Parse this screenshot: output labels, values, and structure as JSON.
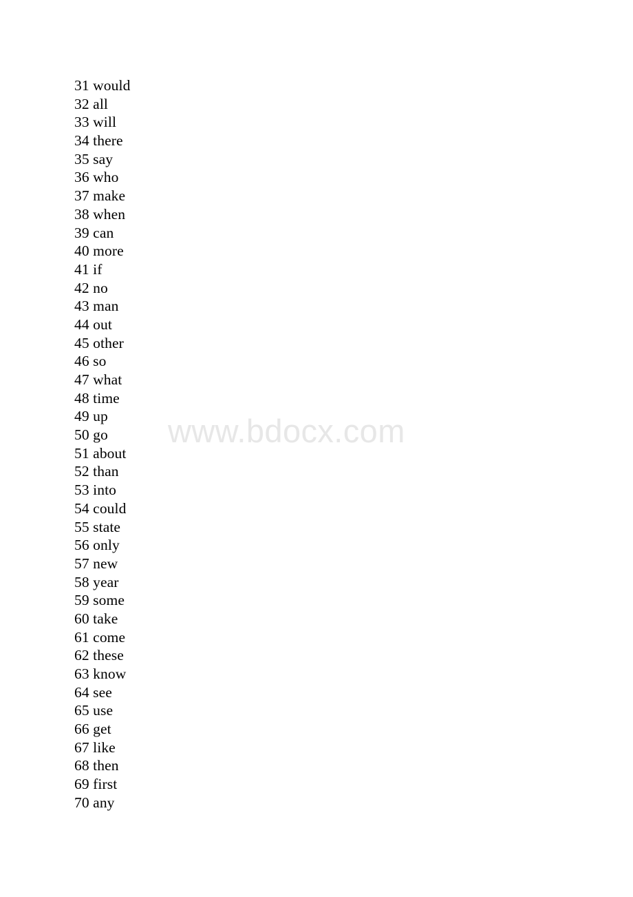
{
  "document": {
    "background_color": "#ffffff",
    "text_color": "#000000",
    "watermark": {
      "text": "www.bdocx.com",
      "color": "#e7e7e7"
    }
  },
  "word_list": {
    "items": [
      {
        "number": "31",
        "word": "would",
        "line": "31 would"
      },
      {
        "number": "32",
        "word": "all",
        "line": "32 all"
      },
      {
        "number": "33",
        "word": "will",
        "line": "33 will"
      },
      {
        "number": "34",
        "word": "there",
        "line": "34 there"
      },
      {
        "number": "35",
        "word": "say",
        "line": "35 say"
      },
      {
        "number": "36",
        "word": "who",
        "line": "36 who"
      },
      {
        "number": "37",
        "word": "make",
        "line": "37 make"
      },
      {
        "number": "38",
        "word": "when",
        "line": "38 when"
      },
      {
        "number": "39",
        "word": "can",
        "line": "39 can"
      },
      {
        "number": "40",
        "word": "more",
        "line": "40 more"
      },
      {
        "number": "41",
        "word": "if",
        "line": "41 if"
      },
      {
        "number": "42",
        "word": "no",
        "line": "42 no"
      },
      {
        "number": "43",
        "word": "man",
        "line": "43 man"
      },
      {
        "number": "44",
        "word": "out",
        "line": "44 out"
      },
      {
        "number": "45",
        "word": "other",
        "line": "45 other"
      },
      {
        "number": "46",
        "word": "so",
        "line": "46 so"
      },
      {
        "number": "47",
        "word": "what",
        "line": "47 what"
      },
      {
        "number": "48",
        "word": "time",
        "line": "48 time"
      },
      {
        "number": "49",
        "word": "up",
        "line": "49 up"
      },
      {
        "number": "50",
        "word": "go",
        "line": "50 go"
      },
      {
        "number": "51",
        "word": "about",
        "line": "51 about"
      },
      {
        "number": "52",
        "word": "than",
        "line": "52 than"
      },
      {
        "number": "53",
        "word": "into",
        "line": "53 into"
      },
      {
        "number": "54",
        "word": "could",
        "line": "54 could"
      },
      {
        "number": "55",
        "word": "state",
        "line": "55 state"
      },
      {
        "number": "56",
        "word": "only",
        "line": "56 only"
      },
      {
        "number": "57",
        "word": "new",
        "line": "57 new"
      },
      {
        "number": "58",
        "word": "year",
        "line": "58 year"
      },
      {
        "number": "59",
        "word": "some",
        "line": "59 some"
      },
      {
        "number": "60",
        "word": "take",
        "line": "60 take"
      },
      {
        "number": "61",
        "word": "come",
        "line": "61 come"
      },
      {
        "number": "62",
        "word": "these",
        "line": "62 these"
      },
      {
        "number": "63",
        "word": "know",
        "line": "63 know"
      },
      {
        "number": "64",
        "word": "see",
        "line": "64 see"
      },
      {
        "number": "65",
        "word": "use",
        "line": "65 use"
      },
      {
        "number": "66",
        "word": "get",
        "line": "66 get"
      },
      {
        "number": "67",
        "word": "like",
        "line": "67 like"
      },
      {
        "number": "68",
        "word": "then",
        "line": "68 then"
      },
      {
        "number": "69",
        "word": "first",
        "line": "69 first"
      },
      {
        "number": "70",
        "word": "any",
        "line": "70 any"
      }
    ]
  }
}
